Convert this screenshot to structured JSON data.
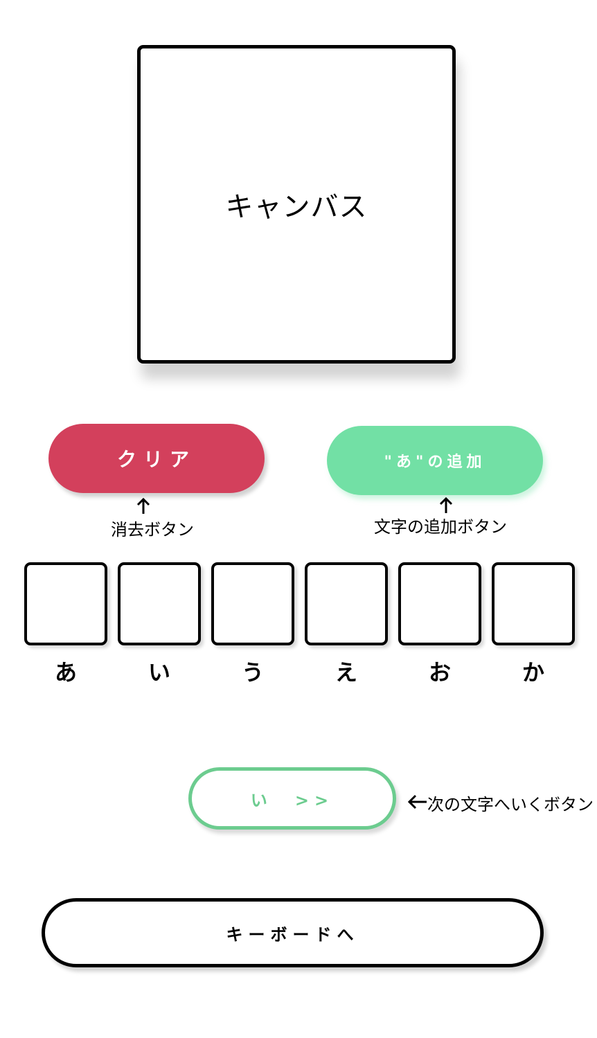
{
  "canvas": {
    "label": "キャンバス"
  },
  "buttons": {
    "clear": "クリア",
    "add": "\"あ\"の追加",
    "next": "い　>>",
    "keyboard": "キーボードへ"
  },
  "annotations": {
    "clear": "消去ボタン",
    "add": "文字の追加ボタン",
    "next": "次の文字へいくボタン"
  },
  "slots": [
    "あ",
    "い",
    "う",
    "え",
    "お",
    "か"
  ],
  "colors": {
    "clear_bg": "#d3405c",
    "add_bg": "#72e0a5",
    "next_border": "#6ccc8f"
  }
}
